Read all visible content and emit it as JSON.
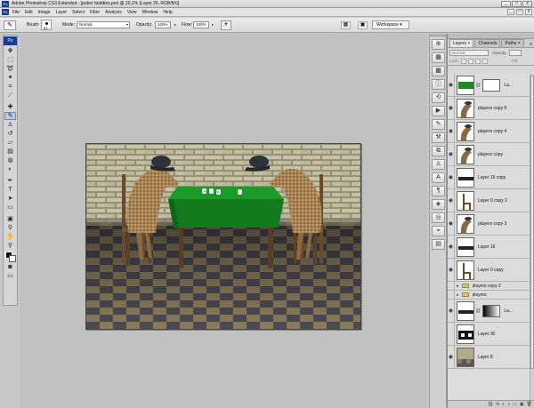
{
  "window": {
    "title": "Adobe Photoshop CS3 Extended - [poker buddies.psd @ 20,1% (Layer 26, RGB/8#)]",
    "app_badge": "Ps",
    "controls": [
      "_",
      "□",
      "x"
    ]
  },
  "menu": {
    "items": [
      "File",
      "Edit",
      "Image",
      "Layer",
      "Select",
      "Filter",
      "Analysis",
      "View",
      "Window",
      "Help"
    ],
    "doc_controls": [
      "_",
      "□",
      "x"
    ]
  },
  "options": {
    "brush_label": "Brush:",
    "brush_size": "64",
    "mode_label": "Mode:",
    "mode_value": "Normal",
    "opacity_label": "Opacity:",
    "opacity_value": "100%",
    "flow_label": "Flow:",
    "flow_value": "100%",
    "workspace_label": "Workspace ▾"
  },
  "toolbox": {
    "logo": "Ps",
    "tools": [
      {
        "name": "move-tool-icon",
        "glyph": "✥"
      },
      {
        "name": "marquee-tool-icon",
        "glyph": "⬚"
      },
      {
        "name": "lasso-tool-icon",
        "glyph": "➰"
      },
      {
        "name": "magic-wand-icon",
        "glyph": "✦"
      },
      {
        "name": "crop-tool-icon",
        "glyph": "⌗"
      },
      {
        "name": "slice-tool-icon",
        "glyph": "⟋"
      },
      {
        "name": "healing-brush-icon",
        "glyph": "✚"
      },
      {
        "name": "brush-tool-icon",
        "glyph": "✎"
      },
      {
        "name": "clone-stamp-icon",
        "glyph": "♙"
      },
      {
        "name": "history-brush-icon",
        "glyph": "↺"
      },
      {
        "name": "eraser-tool-icon",
        "glyph": "▱"
      },
      {
        "name": "gradient-tool-icon",
        "glyph": "▤"
      },
      {
        "name": "blur-tool-icon",
        "glyph": "◍"
      },
      {
        "name": "dodge-tool-icon",
        "glyph": "◐"
      },
      {
        "name": "pen-tool-icon",
        "glyph": "✒"
      },
      {
        "name": "type-tool-icon",
        "glyph": "T"
      },
      {
        "name": "path-select-icon",
        "glyph": "➤"
      },
      {
        "name": "shape-tool-icon",
        "glyph": "▭"
      },
      {
        "name": "notes-tool-icon",
        "glyph": "▣"
      },
      {
        "name": "eyedropper-icon",
        "glyph": "⚲"
      },
      {
        "name": "hand-tool-icon",
        "glyph": "✋"
      },
      {
        "name": "zoom-tool-icon",
        "glyph": "⚲"
      }
    ]
  },
  "dock": {
    "icons": [
      {
        "name": "navigator-icon",
        "glyph": "⊕"
      },
      {
        "name": "color-icon",
        "glyph": "▦"
      },
      {
        "name": "swatches-icon",
        "glyph": "▩"
      },
      {
        "name": "info-icon",
        "glyph": "ⓘ"
      },
      {
        "name": "history-icon",
        "glyph": "⟲"
      },
      {
        "name": "actions-icon",
        "glyph": "▶"
      },
      {
        "name": "brushes-icon",
        "glyph": "✎"
      },
      {
        "name": "tool-presets-icon",
        "glyph": "⚒"
      },
      {
        "name": "layer-comps-icon",
        "glyph": "⧉"
      },
      {
        "name": "clone-source-icon",
        "glyph": "♙"
      },
      {
        "name": "character-icon",
        "glyph": "A"
      },
      {
        "name": "paragraph-icon",
        "glyph": "¶"
      },
      {
        "name": "styles-icon",
        "glyph": "◈"
      },
      {
        "name": "masks-icon",
        "glyph": "◎"
      },
      {
        "name": "measurement-icon",
        "glyph": "⌖"
      },
      {
        "name": "animation-icon",
        "glyph": "▤"
      }
    ]
  },
  "layers_panel": {
    "tabs": [
      "Layers ×",
      "Channels",
      "Paths ×"
    ],
    "blend_mode": "Normal",
    "opacity_label": "Opacity:",
    "lock_label": "Lock:",
    "fill_label": "Fill:",
    "layers": [
      {
        "name": "La...",
        "kind": "big",
        "thumb": "green",
        "mask": true,
        "visible": true
      },
      {
        "name": "players copy 6",
        "kind": "big",
        "thumb": "bird",
        "visible": true
      },
      {
        "name": "players copy 4",
        "kind": "big",
        "thumb": "bird",
        "visible": true
      },
      {
        "name": "players copy",
        "kind": "big",
        "thumb": "bird",
        "visible": true
      },
      {
        "name": "Layer 16 copy",
        "kind": "big",
        "thumb": "strip",
        "visible": true
      },
      {
        "name": "Layer 0 copy 2",
        "kind": "big",
        "thumb": "chair",
        "visible": true
      },
      {
        "name": "players copy 3",
        "kind": "big",
        "thumb": "bird",
        "visible": true
      },
      {
        "name": "Layer 16",
        "kind": "big",
        "thumb": "strip",
        "visible": true
      },
      {
        "name": "Layer 0 copy",
        "kind": "big",
        "thumb": "chair",
        "visible": true
      },
      {
        "name": "players copy 2",
        "kind": "group",
        "visible": false
      },
      {
        "name": "players",
        "kind": "group",
        "visible": false
      },
      {
        "name": "La...",
        "kind": "big",
        "thumb": "strip",
        "mask": true,
        "visible": true
      },
      {
        "name": "Layer 30",
        "kind": "big",
        "thumb": "silhouette",
        "visible": false
      },
      {
        "name": "Layer 8",
        "kind": "big",
        "thumb": "brick",
        "visible": true
      }
    ],
    "bottom_icons": [
      "⛓",
      "fx",
      "◐",
      "◑",
      "▭",
      "▣",
      "🗑"
    ]
  },
  "colors": {
    "accent": "#1b3d8f",
    "table_felt": "#1c8a24"
  }
}
